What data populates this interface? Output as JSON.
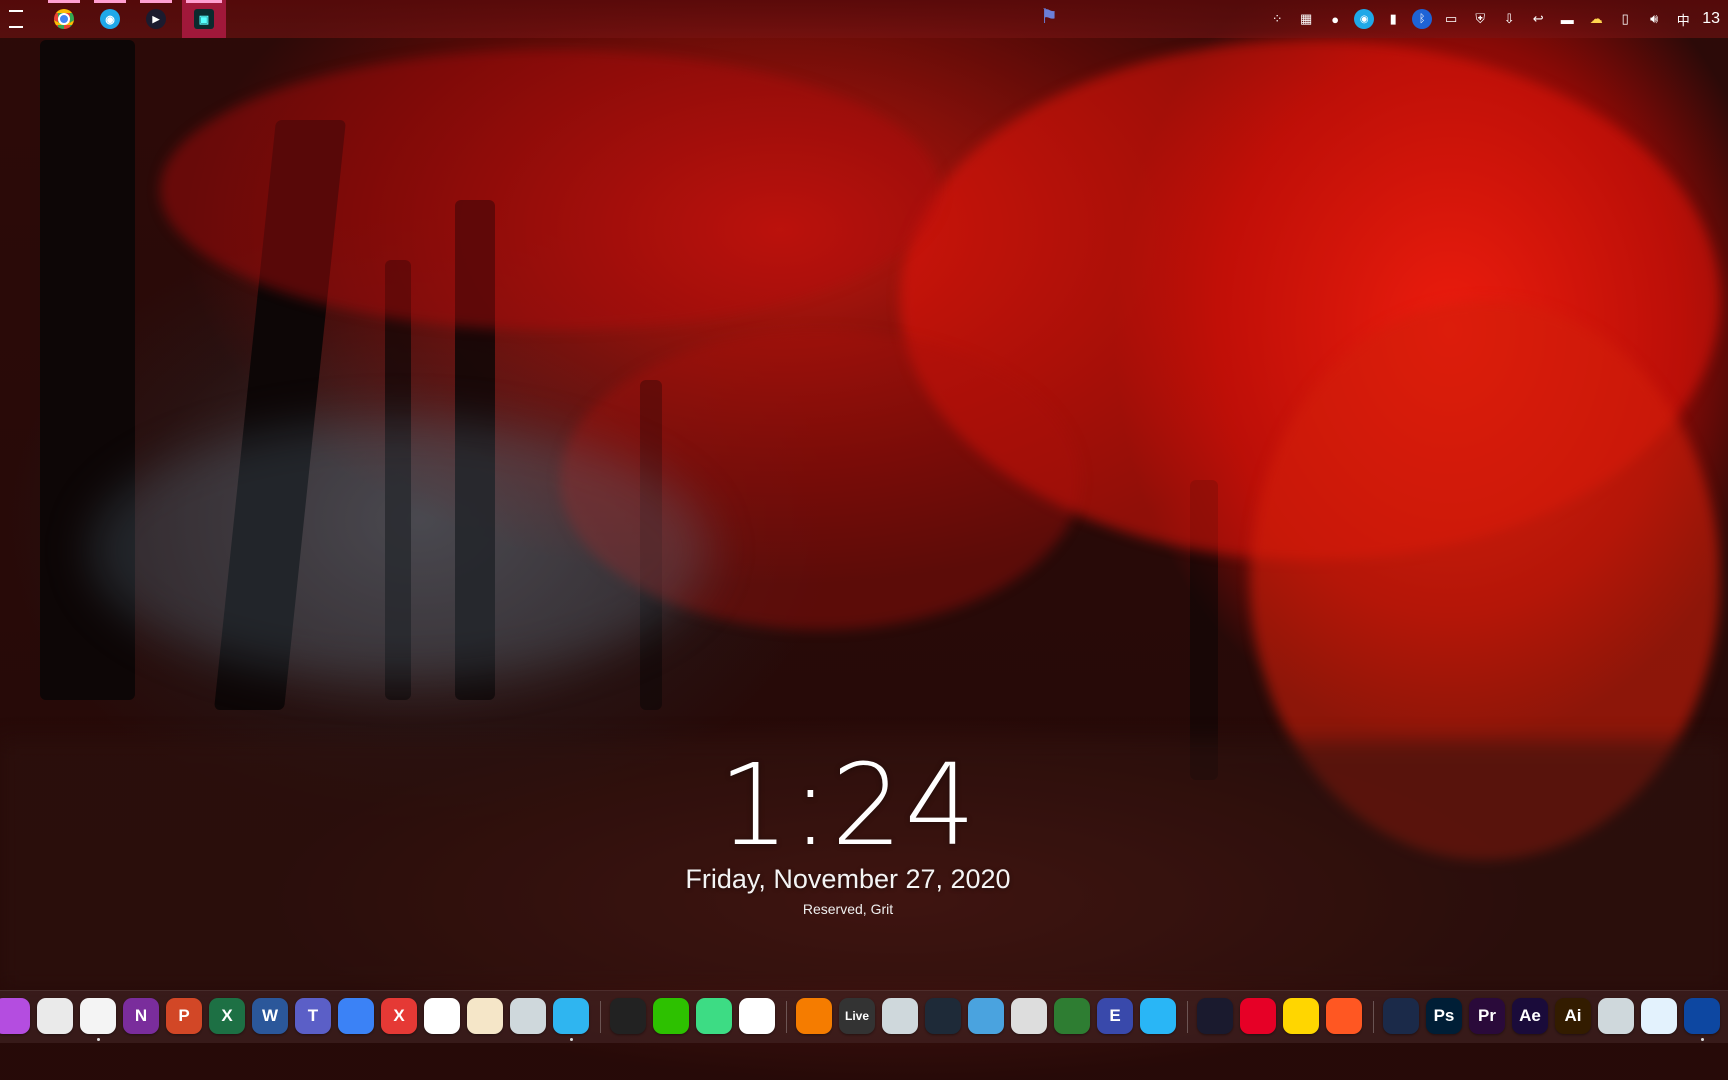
{
  "lock_screen": {
    "time": "1:24",
    "date": "Friday, November 27, 2020",
    "user": "Reserved, Grit"
  },
  "topbar": {
    "task_view_icon": "task-view-icon",
    "apps": [
      {
        "name": "chrome",
        "icon": "chrome-icon"
      },
      {
        "name": "network",
        "icon": "wifi-app-icon"
      },
      {
        "name": "video",
        "icon": "play-icon"
      },
      {
        "name": "remote-desktop",
        "icon": "monitor-icon",
        "active": true
      }
    ],
    "tray_icons": [
      "color-picker-icon",
      "app-grid-icon",
      "drop-icon",
      "wifi-icon",
      "bookmark-icon",
      "bluetooth-icon",
      "display-icon",
      "shield-icon",
      "download-icon",
      "arrow-icon",
      "battery-icon",
      "cloud-icon",
      "usb-icon",
      "volume-icon"
    ],
    "ime": "中",
    "clock": "13"
  },
  "dock": {
    "items": [
      {
        "icon": "folder-icon",
        "label": "",
        "color": "#b44de0"
      },
      {
        "icon": "launchpad-icon",
        "label": "",
        "color": "#eaeaea"
      },
      {
        "icon": "chrome-icon",
        "label": "",
        "color": "#f4f4f4"
      },
      {
        "icon": "onenote-icon",
        "label": "N",
        "color": "#7a2d9c"
      },
      {
        "icon": "powerpoint-icon",
        "label": "P",
        "color": "#d24726"
      },
      {
        "icon": "excel-icon",
        "label": "X",
        "color": "#1d7044"
      },
      {
        "icon": "word-icon",
        "label": "W",
        "color": "#2b579a"
      },
      {
        "icon": "teams-icon",
        "label": "T",
        "color": "#5b5fc7"
      },
      {
        "icon": "tablet-icon",
        "label": "",
        "color": "#3b82f6"
      },
      {
        "icon": "xmind-icon",
        "label": "X",
        "color": "#e53935"
      },
      {
        "icon": "screenshot-icon",
        "label": "",
        "color": "#ffffff"
      },
      {
        "icon": "book-icon",
        "label": "",
        "color": "#f5e6c8"
      },
      {
        "icon": "app-store-icon",
        "label": "",
        "color": "#cfd8dc"
      },
      {
        "icon": "network-app-icon",
        "label": "",
        "color": "#2fb5f0"
      },
      {
        "icon": "qq-icon",
        "label": "",
        "color": "#222222"
      },
      {
        "icon": "wechat-icon",
        "label": "",
        "color": "#2dc100"
      },
      {
        "icon": "play-store-icon",
        "label": "",
        "color": "#3ddc84"
      },
      {
        "icon": "cloud-sync-icon",
        "label": "",
        "color": "#ffffff"
      },
      {
        "icon": "fl-studio-icon",
        "label": "",
        "color": "#f57c00"
      },
      {
        "icon": "ableton-icon",
        "label": "Live",
        "color": "#333333"
      },
      {
        "icon": "power-icon",
        "label": "",
        "color": "#cfd8dc"
      },
      {
        "icon": "audio-icon",
        "label": "",
        "color": "#1e2a38"
      },
      {
        "icon": "record-icon",
        "label": "",
        "color": "#4aa3df"
      },
      {
        "icon": "midi-icon",
        "label": "",
        "color": "#dddddd"
      },
      {
        "icon": "keyboard-icon",
        "label": "",
        "color": "#2e7d32"
      },
      {
        "icon": "e-icon",
        "label": "E",
        "color": "#3949ab"
      },
      {
        "icon": "studio-icon",
        "label": "",
        "color": "#29b6f6"
      },
      {
        "icon": "video-player-icon",
        "label": "",
        "color": "#1a1a2e"
      },
      {
        "icon": "netease-music-icon",
        "label": "",
        "color": "#e60026"
      },
      {
        "icon": "music-icon",
        "label": "",
        "color": "#ffd600"
      },
      {
        "icon": "audio-editor-icon",
        "label": "",
        "color": "#ff5722"
      },
      {
        "icon": "cinema4d-icon",
        "label": "",
        "color": "#1b2a49"
      },
      {
        "icon": "photoshop-icon",
        "label": "Ps",
        "color": "#001e36"
      },
      {
        "icon": "premiere-icon",
        "label": "Pr",
        "color": "#2a0a3a"
      },
      {
        "icon": "after-effects-icon",
        "label": "Ae",
        "color": "#1a0b3a"
      },
      {
        "icon": "illustrator-icon",
        "label": "Ai",
        "color": "#331c00"
      },
      {
        "icon": "cube-icon",
        "label": "",
        "color": "#cfd8dc"
      },
      {
        "icon": "affinity-icon",
        "label": "",
        "color": "#e3f2fd"
      },
      {
        "icon": "screen-record-icon",
        "label": "",
        "color": "#0d47a1"
      }
    ]
  },
  "colors": {
    "accent": "#a0183a",
    "dock_bg": "#463030",
    "tab_mark": "#ff9fd0"
  }
}
